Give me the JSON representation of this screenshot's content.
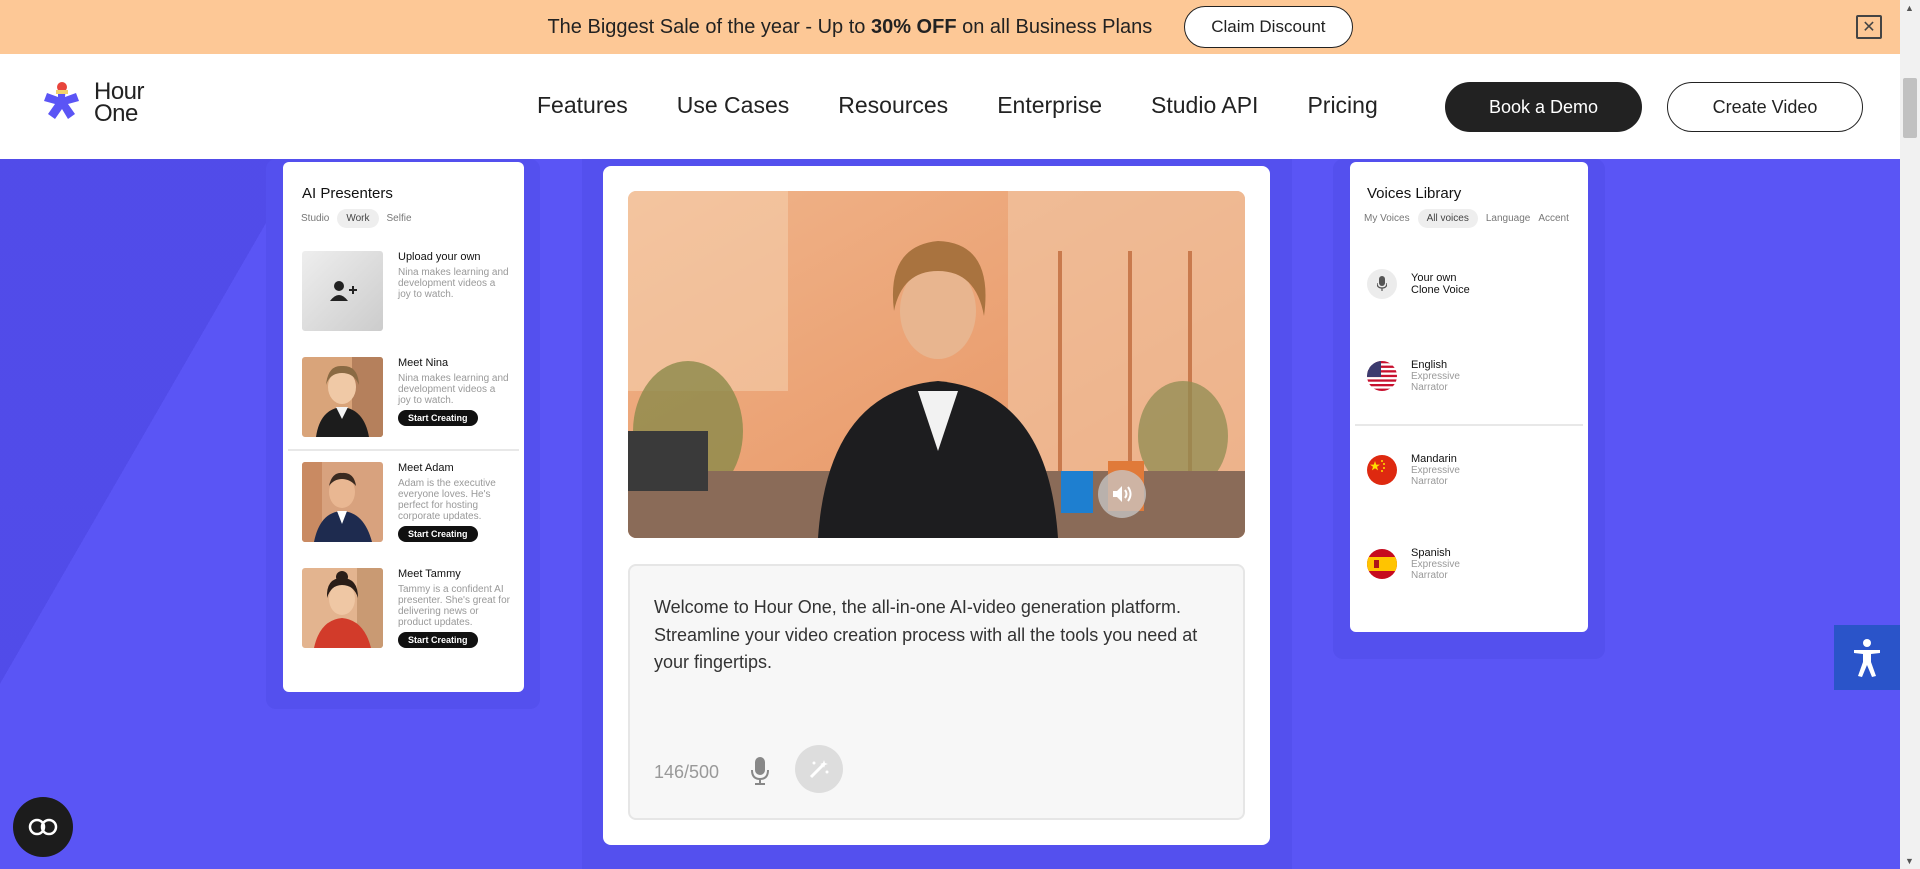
{
  "promo": {
    "text_before": "The Biggest Sale of the year - Up to ",
    "text_bold": "30% OFF",
    "text_after": " on all Business Plans",
    "button": "Claim Discount"
  },
  "nav": {
    "logo_line1": "Hour",
    "logo_line2": "One",
    "links": [
      "Features",
      "Use Cases",
      "Resources",
      "Enterprise",
      "Studio API",
      "Pricing"
    ],
    "demo_button": "Book a Demo",
    "create_button": "Create Video"
  },
  "presenters": {
    "title": "AI Presenters",
    "tabs": [
      "Studio",
      "Work",
      "Selfie"
    ],
    "active_tab": "Work",
    "items": [
      {
        "name": "Upload your own",
        "desc": "Nina makes learning and development videos a joy to watch.",
        "button": ""
      },
      {
        "name": "Meet Nina",
        "desc": "Nina makes learning and development videos a joy to watch.",
        "button": "Start Creating"
      },
      {
        "name": "Meet Adam",
        "desc": "Adam is the executive everyone loves. He's perfect for hosting corporate updates.",
        "button": "Start Creating"
      },
      {
        "name": "Meet Tammy",
        "desc": "Tammy is a confident AI presenter. She's great for delivering news or product updates.",
        "button": "Start Creating"
      }
    ]
  },
  "editor": {
    "line1": "Welcome to Hour One, the all-in-one AI-video generation platform.",
    "line2": "Streamline your video creation process with all the tools you need at your fingertips.",
    "count": "146/500"
  },
  "voices": {
    "title": "Voices Library",
    "tabs": [
      "My Voices",
      "All voices",
      "Language",
      "Accent"
    ],
    "active_tab": "All voices",
    "clone_line1": "Your own",
    "clone_line2": "Clone Voice",
    "items": [
      {
        "lang": "English",
        "style": "Expressive",
        "role": "Narrator"
      },
      {
        "lang": "Mandarin",
        "style": "Expressive",
        "role": "Narrator"
      },
      {
        "lang": "Spanish",
        "style": "Expressive",
        "role": "Narrator"
      }
    ]
  },
  "colors": {
    "background": "#5a55f5",
    "banner": "#fdc896",
    "accessibility": "#2a54c9"
  },
  "icons": {
    "close": "close-icon",
    "sound": "speaker-icon",
    "mic": "microphone-icon",
    "wand": "magic-wand-icon",
    "a11y": "accessibility-icon",
    "chat": "chat-icon"
  }
}
